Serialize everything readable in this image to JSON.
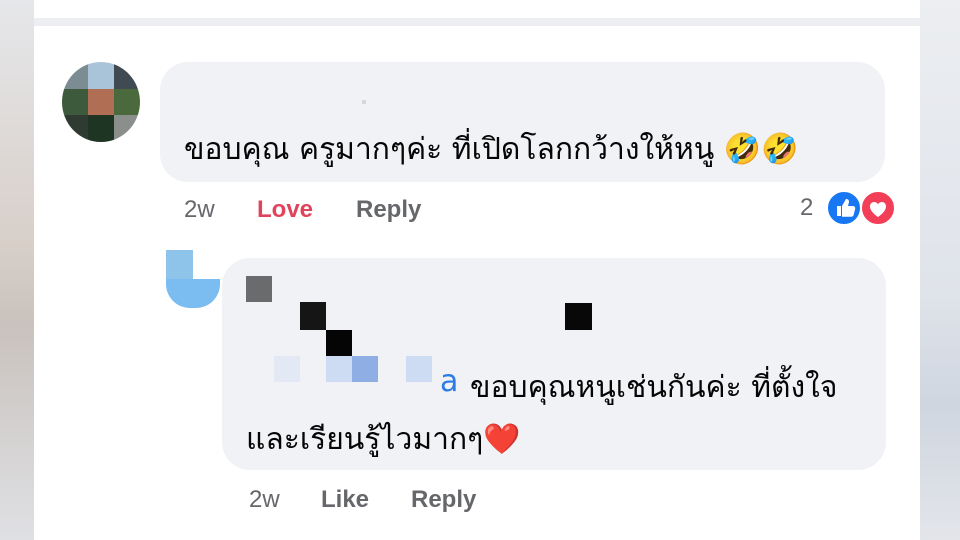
{
  "colors": {
    "bubble_bg": "#f0f2f5",
    "love_red": "#e0445c",
    "like_blue": "#1877f2",
    "name_blue": "#2d7be5",
    "meta_gray": "#65676b"
  },
  "comment": {
    "text": "ขอบคุณ ครูมากๆค่ะ ที่เปิดโลกกว้างให้หนู 🤣🤣",
    "time": "2w",
    "action_love": "Love",
    "action_reply": "Reply",
    "reaction_count": "2",
    "reaction_icons": [
      "like-icon",
      "heart-icon"
    ]
  },
  "reply": {
    "name_visible_fragment": "a",
    "text_line1": "ขอบคุณหนูเช่นกันค่ะ ที่ตั้งใจ",
    "text_line2": "และเรียนรู้ไวมากๆ❤️",
    "time": "2w",
    "action_like": "Like",
    "action_reply": "Reply"
  }
}
